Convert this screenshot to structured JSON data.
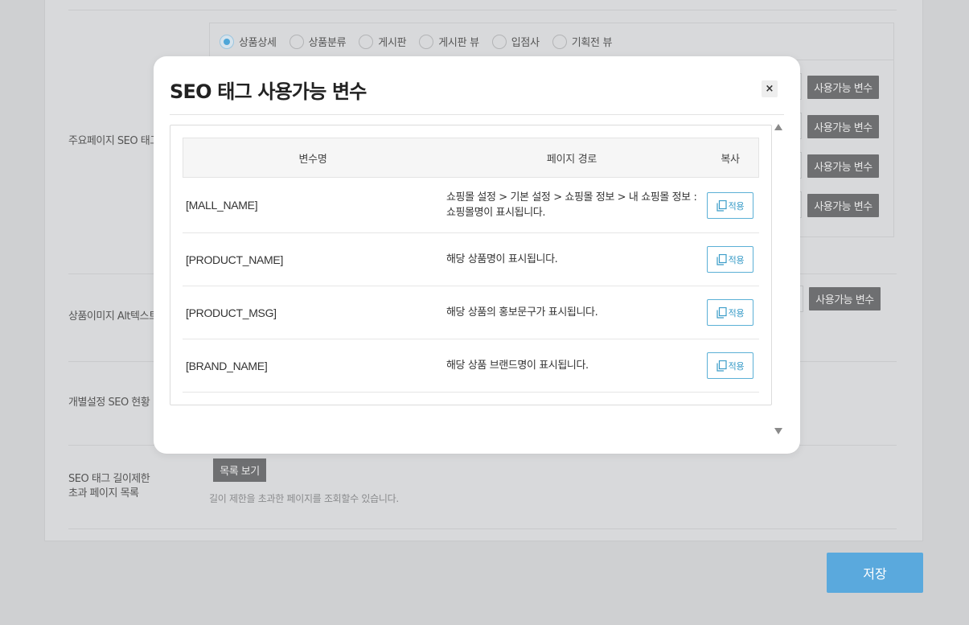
{
  "background": {
    "radio_options": [
      {
        "label": "상품상세",
        "checked": true
      },
      {
        "label": "상품분류",
        "checked": false
      },
      {
        "label": "게시판",
        "checked": false
      },
      {
        "label": "게시판 뷰",
        "checked": false
      },
      {
        "label": "입점사",
        "checked": false
      },
      {
        "label": "기획전 뷰",
        "checked": false
      }
    ],
    "labels": {
      "main_page_seo": "주요페이지 SEO 태그",
      "image_alt": "상품이미지 Alt텍스트",
      "individual_seo": "개별설정 SEO 현황",
      "length_limit_line1": "SEO 태그 길이제한",
      "length_limit_line2": "초과 페이지 목록"
    },
    "var_button_label": "사용가능 변수",
    "list_button_label": "목록 보기",
    "length_hint": "길이 제한을 초과한 페이지를 조회할수 있습니다.",
    "save_label": "저장"
  },
  "modal": {
    "title": "SEO 태그 사용가능 변수",
    "close_icon": "×",
    "columns": {
      "name": "변수명",
      "path": "페이지 경로",
      "copy": "복사"
    },
    "copy_label": "적용",
    "rows": [
      {
        "name": "[MALL_NAME]",
        "path": "쇼핑몰 설정 > 기본 설정 > 쇼핑몰 정보 > 내 쇼핑몰 정보 : 쇼핑몰명이 표시됩니다."
      },
      {
        "name": "[PRODUCT_NAME]",
        "path": "해당 상품명이 표시됩니다."
      },
      {
        "name": "[PRODUCT_MSG]",
        "path": "해당 상품의 홍보문구가 표시됩니다."
      },
      {
        "name": "[BRAND_NAME]",
        "path": "해당 상품 브랜드명이 표시됩니다."
      }
    ]
  },
  "colors": {
    "accent": "#5aa9dd",
    "copy_button_border": "#5bb0d6",
    "dark_button": "#6e6f71",
    "overlay_background": "#cfd0d2"
  }
}
